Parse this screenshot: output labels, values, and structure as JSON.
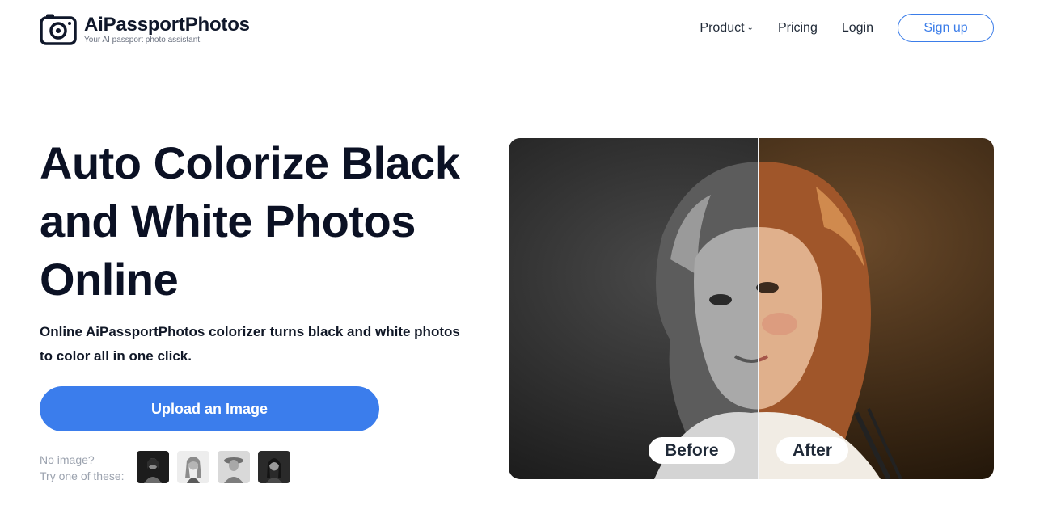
{
  "brand": {
    "name": "AiPassportPhotos",
    "tagline": "Your AI passport photo assistant."
  },
  "nav": {
    "product": "Product",
    "pricing": "Pricing",
    "login": "Login",
    "signup": "Sign up"
  },
  "hero": {
    "title": "Auto Colorize Black and White Photos Online",
    "subtitle": "Online AiPassportPhotos colorizer turns black and white photos to color all in one click.",
    "upload_button": "Upload an Image",
    "samples_line1": "No image?",
    "samples_line2": "Try one of these:"
  },
  "compare": {
    "before_label": "Before",
    "after_label": "After"
  },
  "colors": {
    "accent": "#3b7dec",
    "text_dark": "#0b1124",
    "muted": "#9ca3af"
  }
}
